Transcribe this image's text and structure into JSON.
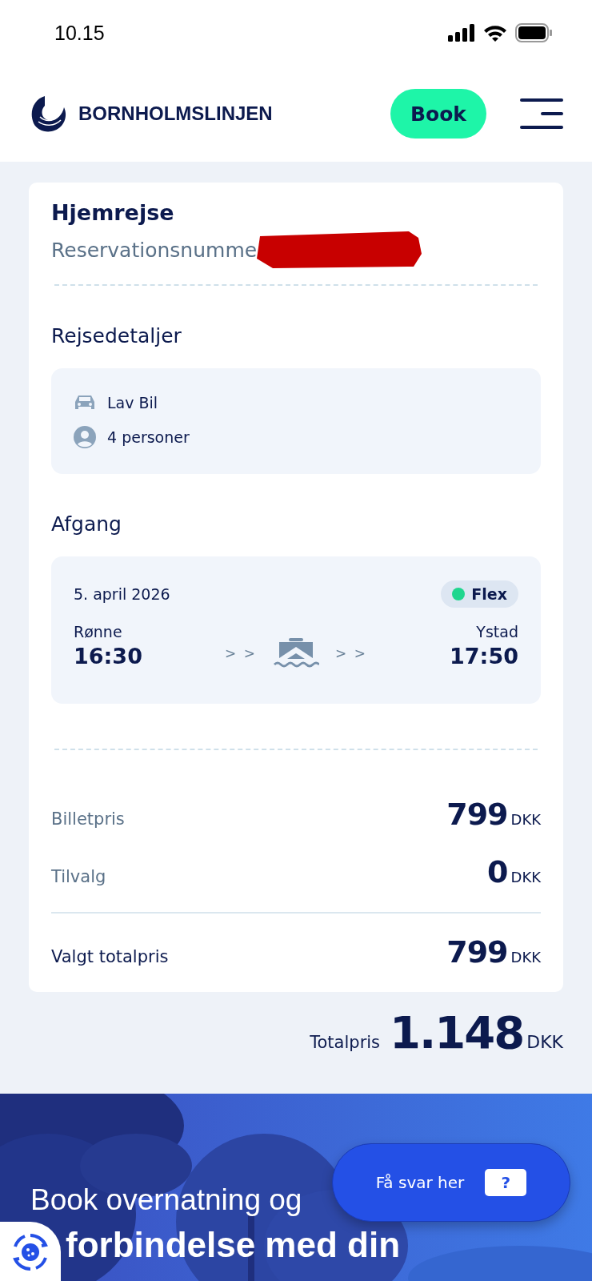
{
  "status_bar": {
    "time": "10.15"
  },
  "header": {
    "brand": "BORNHOLMSLINJEN",
    "book_button": "Book"
  },
  "ticket": {
    "title": "Hjemrejse",
    "reservation_label": "Reservationsnumme",
    "details_heading": "Rejsedetaljer",
    "details": [
      {
        "kind": "car",
        "label": "Lav Bil"
      },
      {
        "kind": "person",
        "label": "4 personer"
      }
    ],
    "departure_heading": "Afgang",
    "departure": {
      "date": "5. april 2026",
      "fare": {
        "label": "Flex",
        "color": "#1fd68e"
      },
      "from": {
        "place": "Rønne",
        "time": "16:30"
      },
      "to": {
        "place": "Ystad",
        "time": "17:50"
      },
      "arrows": "> >"
    },
    "prices": [
      {
        "label": "Billetpris",
        "amount": "799",
        "currency": "DKK",
        "kind": "line"
      },
      {
        "label": "Tilvalg",
        "amount": "0",
        "currency": "DKK",
        "kind": "line"
      },
      {
        "label": "Valgt totalpris",
        "amount": "799",
        "currency": "DKK",
        "kind": "total"
      }
    ]
  },
  "grand_total": {
    "label": "Totalpris",
    "amount": "1.148",
    "currency": "DKK"
  },
  "banner": {
    "kind": "picture",
    "line_1": "Book overnatning og",
    "line_2": "forbindelse med din"
  },
  "chat_button": {
    "label": "Få svar her",
    "icon_text": "?"
  }
}
